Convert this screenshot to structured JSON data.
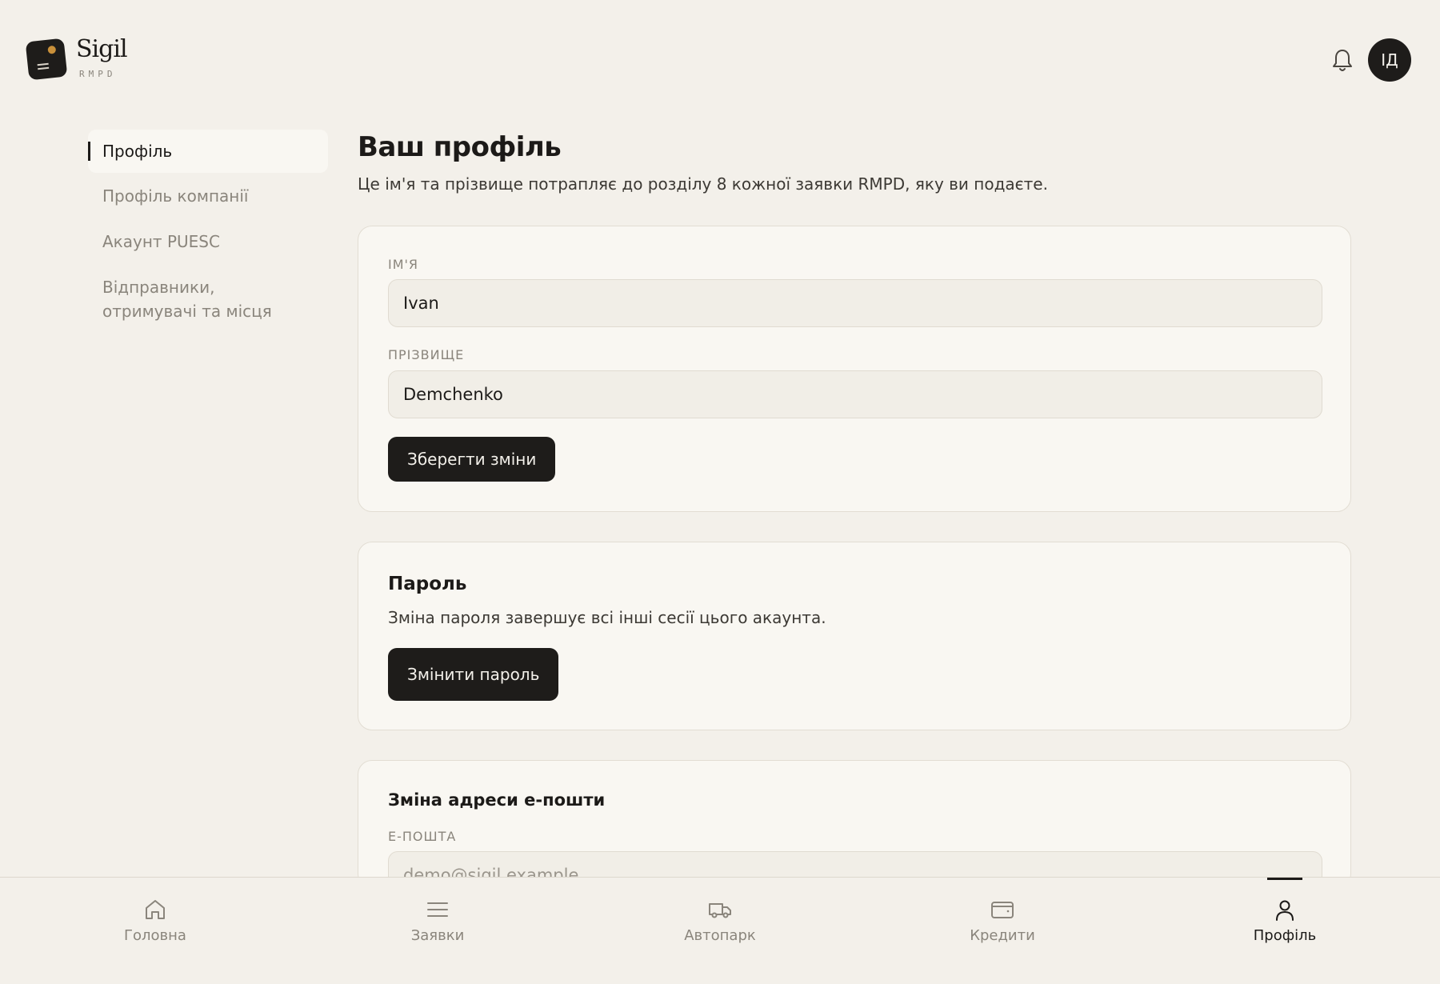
{
  "app": {
    "name": "Sigil",
    "sub": "RMPD"
  },
  "header": {
    "avatar_initials": "ІД"
  },
  "sidebar": {
    "items": [
      {
        "label": "Профіль",
        "active": true
      },
      {
        "label": "Профіль компанії"
      },
      {
        "label": "Акаунт PUESC"
      },
      {
        "label": "Відправники, отримувачі та місця"
      }
    ]
  },
  "page": {
    "title": "Ваш профіль",
    "subtitle": "Це ім'я та прізвище потрапляє до розділу 8 кожної заявки RMPD, яку ви подаєте."
  },
  "profile_form": {
    "first_name_label": "ІМ'Я",
    "first_name_value": "Ivan",
    "last_name_label": "ПРІЗВИЩЕ",
    "last_name_value": "Demchenko",
    "save_label": "Зберегти зміни"
  },
  "password": {
    "title": "Пароль",
    "text": "Зміна пароля завершує всі інші сесії цього акаунта.",
    "button_label": "Змінити пароль"
  },
  "email": {
    "title": "Зміна адреси е-пошти",
    "label": "Е-ПОШТА",
    "value": "demo@sigil.example"
  },
  "bottom_nav": {
    "items": [
      {
        "label": "Головна",
        "icon": "home-icon"
      },
      {
        "label": "Заявки",
        "icon": "list-icon"
      },
      {
        "label": "Автопарк",
        "icon": "truck-icon"
      },
      {
        "label": "Кредити",
        "icon": "wallet-icon"
      },
      {
        "label": "Профіль",
        "icon": "user-icon",
        "active": true
      }
    ]
  },
  "colors": {
    "background": "#f3f0ea",
    "card": "#f9f7f2",
    "dark": "#1e1c1a",
    "accent": "#c9903a",
    "muted": "#8a857c"
  }
}
